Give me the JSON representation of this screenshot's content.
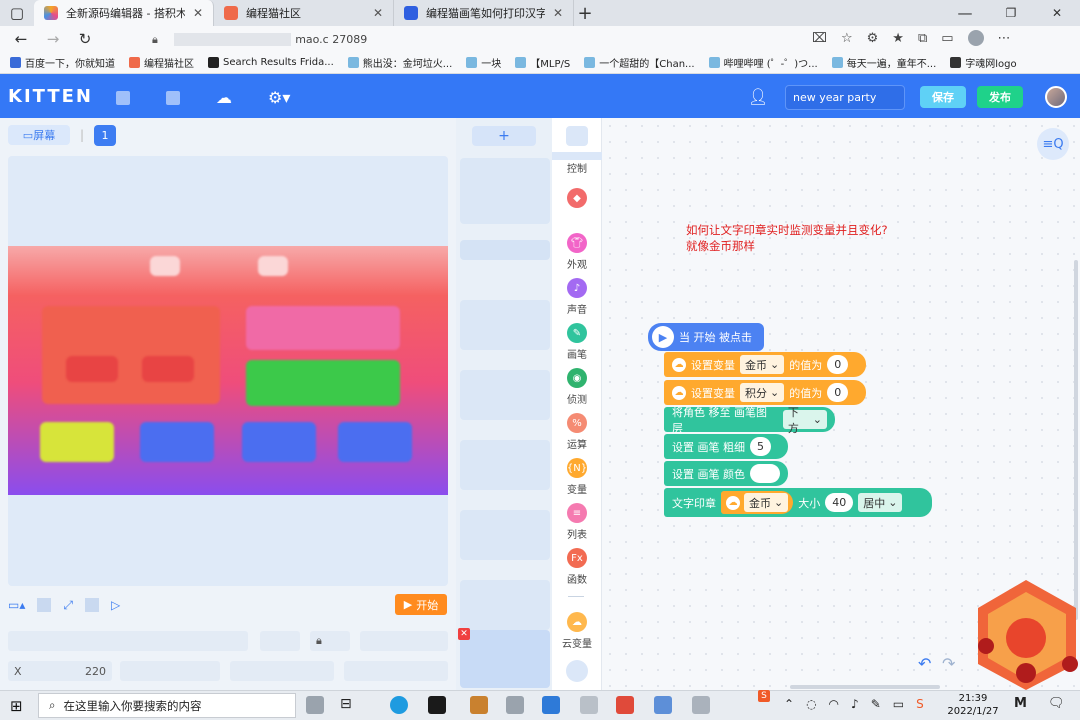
{
  "browser": {
    "tabs": [
      {
        "title": "全新源码编辑器 - 搭积木~",
        "active": true
      },
      {
        "title": "编程猫社区",
        "active": false
      },
      {
        "title": "编程猫画笔如何打印汉字_百度",
        "active": false
      }
    ],
    "url": "mao.c     27089",
    "bookmarks": [
      "百度一下，你就知道",
      "编程猫社区",
      "Search Results Frida...",
      "熊出没：金坷垃火...",
      "一块",
      "【MLP/S",
      "一个超甜的【Chan...",
      "哔哩哔哩 (゜-゜)つ...",
      "每天一遍，童年不...",
      "字魂网logo"
    ]
  },
  "app": {
    "logo": "KITTEN",
    "project_title": "new year party",
    "save_label": "保存",
    "publish_label": "发布"
  },
  "stage": {
    "screen_label": "屏幕",
    "page_number": "1",
    "start_label": "开始",
    "x_label": "X",
    "x_value": "220"
  },
  "sprites": {
    "add_label": "+"
  },
  "categories": [
    {
      "label": "控制",
      "color": "#ffffff"
    },
    {
      "label": "",
      "color": "#f26b6b"
    },
    {
      "label": "外观",
      "color": "#f265c8"
    },
    {
      "label": "声音",
      "color": "#a36af2"
    },
    {
      "label": "画笔",
      "color": "#30c49d"
    },
    {
      "label": "侦测",
      "color": "#2fb36e"
    },
    {
      "label": "运算",
      "color": "#f58b73"
    },
    {
      "label": "变量",
      "color": "#ffa92e"
    },
    {
      "label": "列表",
      "color": "#f57ab0"
    },
    {
      "label": "函数",
      "color": "#f26b52"
    },
    {
      "label": "云变量",
      "color": "#ffb84d"
    }
  ],
  "script": {
    "note_line1": "如何让文字印章实时监测变量并且变化?",
    "note_line2": "就像金币那样",
    "blocks": {
      "when_start": "当 开始 被点击",
      "set_var_1_prefix": "设置变量",
      "set_var_1_var": "金币",
      "set_var_1_mid": "的值为",
      "set_var_1_val": "0",
      "set_var_2_prefix": "设置变量",
      "set_var_2_var": "积分",
      "set_var_2_mid": "的值为",
      "set_var_2_val": "0",
      "move_layer_prefix": "将角色 移至 画笔图层",
      "move_layer_val": "下方",
      "pen_size_prefix": "设置 画笔 粗细",
      "pen_size_val": "5",
      "pen_color_prefix": "设置 画笔 颜色",
      "stamp_prefix": "文字印章",
      "stamp_var": "金币",
      "stamp_size_label": "大小",
      "stamp_size_val": "40",
      "stamp_align": "居中"
    }
  },
  "taskbar": {
    "search_placeholder": "在这里输入你要搜索的内容",
    "time": "21:39",
    "date": "2022/1/27"
  }
}
